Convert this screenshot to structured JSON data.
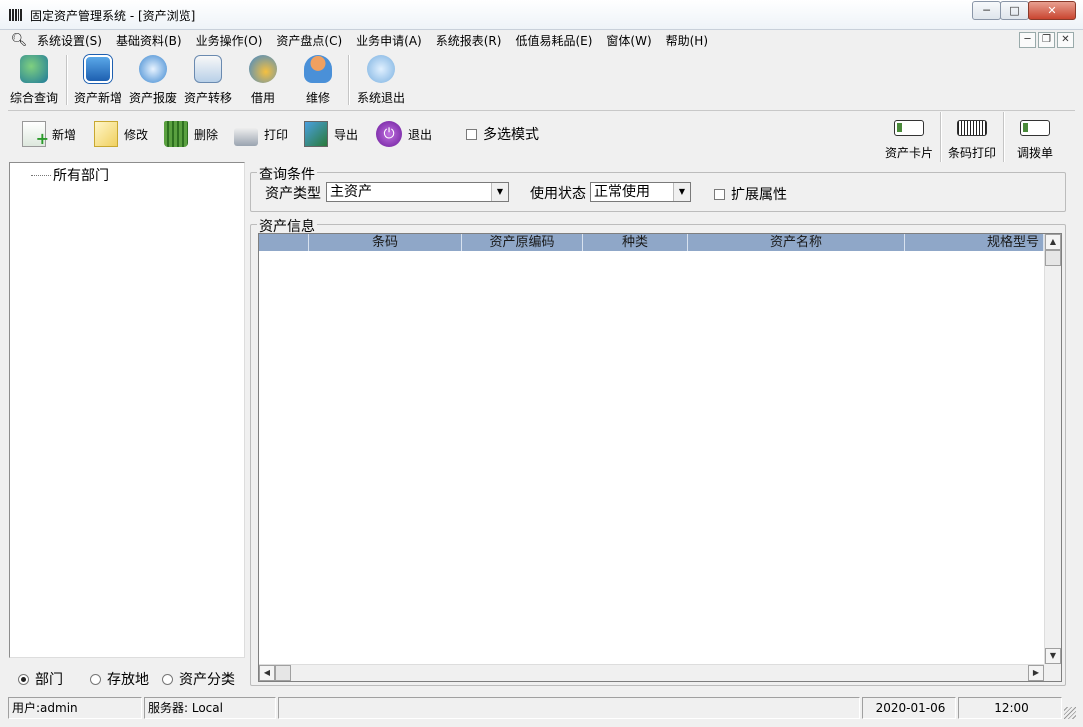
{
  "window": {
    "title": "固定资产管理系统 - [资产浏览]",
    "min_glyph": "─",
    "max_glyph": "□",
    "close_glyph": "✕",
    "mdi_min": "─",
    "mdi_restore": "❐",
    "mdi_close": "✕"
  },
  "menu": {
    "items": [
      "系统设置(S)",
      "基础资料(B)",
      "业务操作(O)",
      "资产盘点(C)",
      "业务申请(A)",
      "系统报表(R)",
      "低值易耗品(E)",
      "窗体(W)",
      "帮助(H)"
    ]
  },
  "main_toolbar": {
    "buttons": [
      {
        "label": "综合查询",
        "icon": "search-globe-icon"
      },
      {
        "label": "资产新增",
        "icon": "add-asset-icon"
      },
      {
        "label": "资产报废",
        "icon": "scrap-asset-icon"
      },
      {
        "label": "资产转移",
        "icon": "transfer-asset-icon"
      },
      {
        "label": "借用",
        "icon": "borrow-icon"
      },
      {
        "label": "维修",
        "icon": "repair-icon"
      },
      {
        "label": "系统退出",
        "icon": "exit-keys-icon"
      }
    ]
  },
  "action_toolbar": {
    "buttons": [
      {
        "label": "新增",
        "icon": "new-document-icon"
      },
      {
        "label": "修改",
        "icon": "edit-document-icon"
      },
      {
        "label": "删除",
        "icon": "trash-icon"
      },
      {
        "label": "打印",
        "icon": "printer-icon"
      },
      {
        "label": "导出",
        "icon": "export-icon"
      },
      {
        "label": "退出",
        "icon": "power-icon"
      }
    ],
    "multi_select_label": "多选模式",
    "multi_select_checked": false,
    "right_buttons": [
      {
        "label": "资产卡片",
        "icon": "card-icon"
      },
      {
        "label": "条码打印",
        "icon": "barcode-icon"
      },
      {
        "label": "调拨单",
        "icon": "card-icon"
      }
    ]
  },
  "tree": {
    "root_label": "所有部门"
  },
  "tree_mode": {
    "options": [
      "部门",
      "存放地",
      "资产分类"
    ],
    "selected": "部门"
  },
  "query": {
    "group_label": "查询条件",
    "asset_type_label": "资产类型",
    "asset_type_value": "主资产",
    "status_label": "使用状态",
    "status_value": "正常使用",
    "ext_label": "扩展属性",
    "ext_checked": false
  },
  "grid": {
    "group_label": "资产信息",
    "columns": [
      "",
      "条码",
      "资产原编码",
      "种类",
      "资产名称",
      "规格型号"
    ],
    "rows": []
  },
  "status": {
    "user": "用户:admin",
    "server": "服务器: Local",
    "date": "2020-01-06",
    "time": "12:00"
  },
  "colors": {
    "grid_header": "#8fa7c8",
    "window_bg": "#f0f0f0",
    "close_button": "#c94530"
  }
}
